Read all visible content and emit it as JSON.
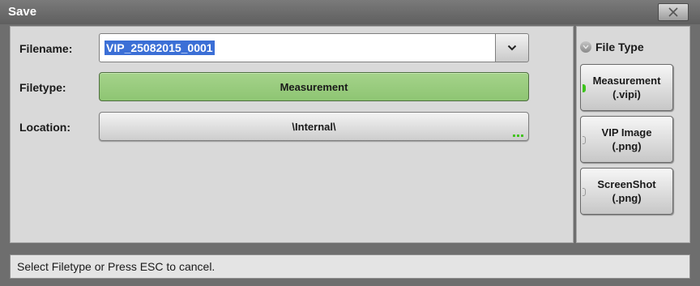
{
  "window": {
    "title": "Save"
  },
  "form": {
    "filename_label": "Filename:",
    "filename_value": "VIP_25082015_0001",
    "filetype_label": "Filetype:",
    "filetype_value": "Measurement",
    "location_label": "Location:",
    "location_value": "\\Internal\\"
  },
  "sidebar": {
    "header": "File Type",
    "options": [
      {
        "line1": "Measurement",
        "line2": "(.vipi)",
        "selected": true
      },
      {
        "line1": "VIP Image",
        "line2": "(.png)",
        "selected": false
      },
      {
        "line1": "ScreenShot",
        "line2": "(.png)",
        "selected": false
      }
    ]
  },
  "status": {
    "text": "Select Filetype or Press ESC to cancel."
  },
  "colors": {
    "accent_green": "#8ec573",
    "indicator_green": "#3ec41c",
    "selection_blue": "#3b6fd6"
  }
}
